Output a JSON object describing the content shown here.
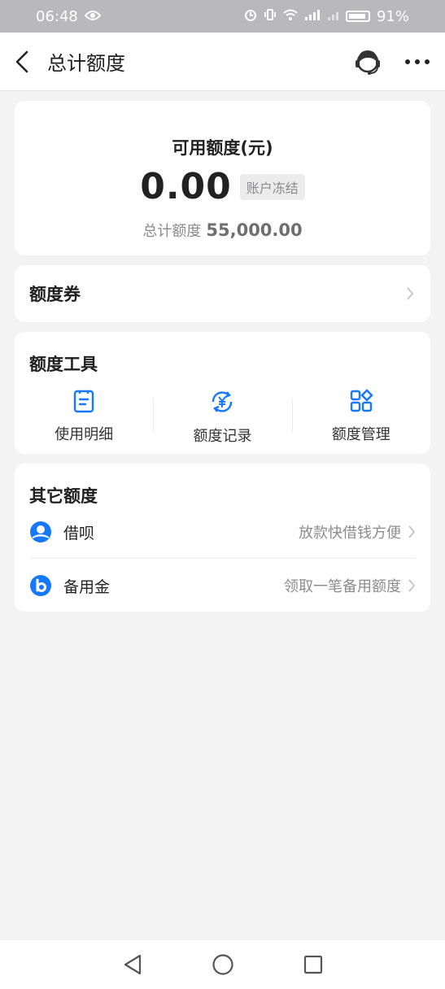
{
  "status_bar": {
    "time": "06:48",
    "battery": "91%"
  },
  "nav": {
    "title": "总计额度"
  },
  "quota": {
    "label": "可用额度(元)",
    "value": "0.00",
    "badge": "账户冻结",
    "total_label": "总计额度",
    "total_value": "55,000.00"
  },
  "voucher": {
    "title": "额度券"
  },
  "tools": {
    "title": "额度工具",
    "items": [
      {
        "label": "使用明细",
        "icon": "document-icon"
      },
      {
        "label": "额度记录",
        "icon": "yuan-cycle-icon"
      },
      {
        "label": "额度管理",
        "icon": "grid-manage-icon"
      }
    ]
  },
  "other": {
    "title": "其它额度",
    "items": [
      {
        "label": "借呗",
        "desc": "放款快借钱方便",
        "icon": "jiebei-icon"
      },
      {
        "label": "备用金",
        "desc": "领取一笔备用额度",
        "icon": "beiyongjin-icon"
      }
    ]
  },
  "colors": {
    "accent": "#1677ff",
    "page_bg": "#f3f3f4",
    "status_bar_bg": "#b9b9bb"
  }
}
